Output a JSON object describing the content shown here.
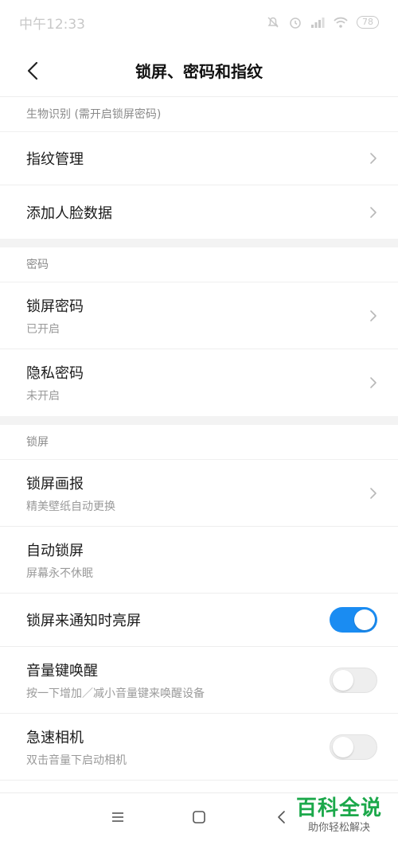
{
  "status": {
    "time": "中午12:33",
    "battery": "78",
    "icons": [
      "alarm-off-icon",
      "alarm-icon",
      "signal-icon",
      "wifi-icon",
      "battery-icon"
    ]
  },
  "header": {
    "title": "锁屏、密码和指纹",
    "back_icon": "back-arrow-icon"
  },
  "sections": {
    "biometric": {
      "label": "生物识别 (需开启锁屏密码)",
      "items": [
        {
          "title": "指纹管理"
        },
        {
          "title": "添加人脸数据"
        }
      ]
    },
    "password": {
      "label": "密码",
      "items": [
        {
          "title": "锁屏密码",
          "subtitle": "已开启"
        },
        {
          "title": "隐私密码",
          "subtitle": "未开启"
        }
      ]
    },
    "lockscreen": {
      "label": "锁屏",
      "items": [
        {
          "title": "锁屏画报",
          "subtitle": "精美壁纸自动更换"
        },
        {
          "title": "自动锁屏",
          "subtitle": "屏幕永不休眠"
        },
        {
          "title": "锁屏来通知时亮屏",
          "toggle": "on"
        },
        {
          "title": "音量键唤醒",
          "subtitle": "按一下增加／减小音量键来唤醒设备",
          "toggle": "off"
        },
        {
          "title": "急速相机",
          "subtitle": "双击音量下启动相机",
          "toggle": "off"
        }
      ]
    }
  },
  "nav": {
    "icons": [
      "menu-icon",
      "home-icon",
      "back-icon"
    ]
  },
  "watermark": {
    "main": "百科全说",
    "sub": "助你轻松解决"
  },
  "colors": {
    "accent": "#1a8cf2",
    "watermark": "#1ba84a"
  }
}
